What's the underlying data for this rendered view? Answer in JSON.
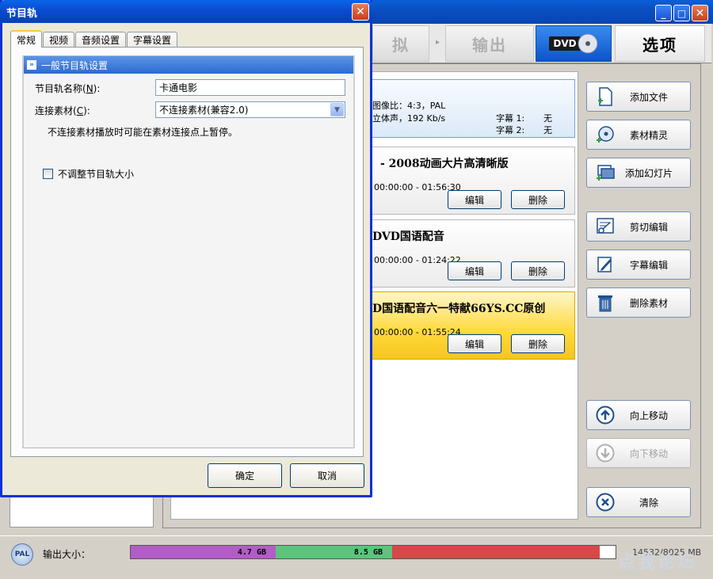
{
  "main": {
    "top_tabs": {
      "simulate": "拟",
      "output": "输出",
      "dvd": "DVD",
      "options": "选项"
    },
    "info": {
      "aspect": "图像比：4:3，PAL",
      "audio": "立体声，192 Kb/s",
      "subtitle1_label": "字幕 1:",
      "subtitle1_value": "无",
      "subtitle2_label": "字幕 2:",
      "subtitle2_value": "无"
    },
    "tracks": [
      {
        "title": "- 2008动画大片高清晰版",
        "time": "00:00:00 - 01:56:30",
        "edit": "编辑",
        "delete": "删除"
      },
      {
        "title": "DVD国语配音",
        "time": "00:00:00 - 01:24:22",
        "edit": "编辑",
        "delete": "删除"
      },
      {
        "title": "D国语配音六一特献66YS.CC原创",
        "time": "00:00:00 - 01:55:24",
        "edit": "编辑",
        "delete": "删除"
      }
    ],
    "side_buttons": {
      "add_file": "添加文件",
      "material_wizard": "素材精灵",
      "add_slideshow": "添加幻灯片",
      "cut_edit": "剪切编辑",
      "subtitle_edit": "字幕编辑",
      "delete_material": "删除素材",
      "move_up": "向上移动",
      "move_down": "向下移动",
      "clear": "清除"
    },
    "status": {
      "pal": "PAL",
      "size_label": "输出大小：",
      "seg1": "4.7 GB",
      "seg2": "8.5 GB",
      "count": "14532/8025 MB"
    },
    "watermark": "点我论坛"
  },
  "dialog": {
    "title": "节目轨",
    "close": "✕",
    "tabs": [
      "常规",
      "视频",
      "音频设置",
      "字幕设置"
    ],
    "group_title": "一般节目轨设置",
    "name_label_pre": "节目轨名称(",
    "name_label_key": "N",
    "name_label_post": "):",
    "name_value": "卡通电影",
    "connect_label_pre": "连接素材(",
    "connect_label_key": "C",
    "connect_label_post": "):",
    "connect_value": "不连接素材(兼容2.0)",
    "hint": "不连接素材播放时可能在素材连接点上暂停。",
    "checkbox_label": "不调整节目轨大小",
    "ok": "确定",
    "cancel": "取消"
  },
  "colors": {
    "seg1": "#b35cc8",
    "seg2": "#5cc47c",
    "seg3": "#d84848",
    "selected_track": "#ffd93a"
  }
}
